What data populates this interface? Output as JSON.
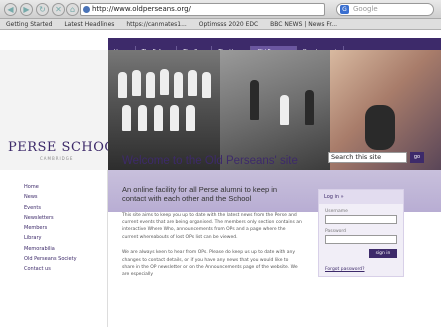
{
  "browser": {
    "url": "http://www.oldperseans.org/",
    "search_engine": "Google",
    "bookmarks": [
      "Getting Started",
      "Latest Headlines",
      "https://canmates1...",
      "Optimsss 2020 EDC",
      "BBC NEWS | News Fr..."
    ]
  },
  "site": {
    "logo": "PERSE SCHOOL",
    "logo_sub": "CAMBRIDGE",
    "tabs": [
      "Home",
      "The Pelican",
      "The Prep",
      "The Upper",
      "Old Perseans",
      "Development"
    ],
    "active_tab": "Old Perseans",
    "sidebar": [
      "Home",
      "News",
      "Events",
      "Newsletters",
      "Members",
      "Library",
      "Memorabilia",
      "Old Perseans Society",
      "Contact us"
    ],
    "welcome": "Welcome to the Old Perseans' site",
    "search_placeholder": "Search this site",
    "search_button": "go",
    "headline": "An online facility for all Perse alumni to keep in contact with each other and the School",
    "para1": "This site aims to keep you up to date with the latest news from the Perse and current events that are being organised. The members only section contains an interactive Where Who, announcements from OPs and a page where the current whereabouts of lost OPs list can be viewed.",
    "para2": "We are always keen to hear from OPs. Please do keep us up to date with any changes to contact details, or if you have any news that you would like to share in the OP newsletter or on the Announcements page of the website. We are especially",
    "login": {
      "title": "Log in »",
      "username_label": "Username",
      "password_label": "Password",
      "signin": "sign in",
      "forgot": "Forgot password?"
    }
  }
}
